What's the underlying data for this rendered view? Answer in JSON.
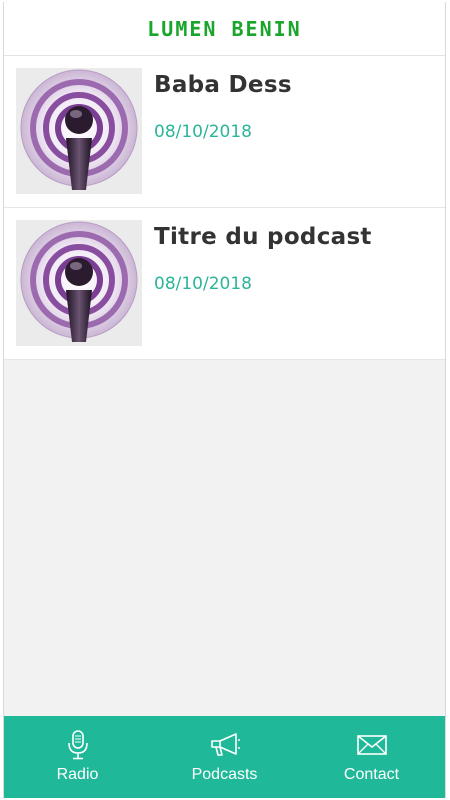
{
  "app": {
    "title": "LUMEN BENIN"
  },
  "podcasts": [
    {
      "title": "Baba Dess",
      "date": "08/10/2018",
      "icon": "podcast-icon"
    },
    {
      "title": "Titre du podcast",
      "date": "08/10/2018",
      "icon": "podcast-icon"
    }
  ],
  "tabs": [
    {
      "label": "Radio",
      "icon": "microphone-icon"
    },
    {
      "label": "Podcasts",
      "icon": "megaphone-icon"
    },
    {
      "label": "Contact",
      "icon": "envelope-icon"
    }
  ],
  "colors": {
    "brand": "#1aa52c",
    "accent": "#1fb999",
    "date": "#2bb59a"
  }
}
